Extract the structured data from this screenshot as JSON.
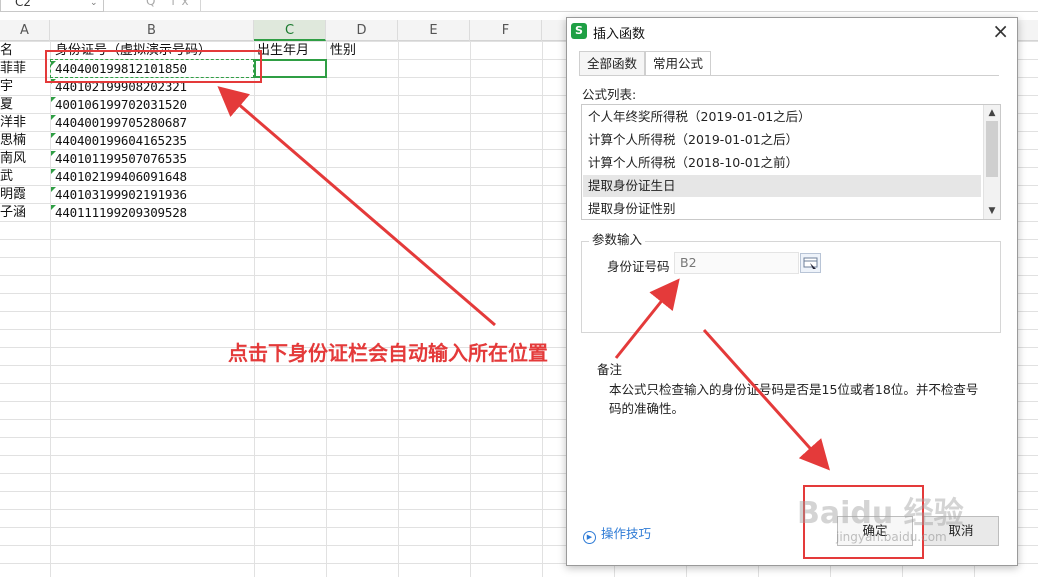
{
  "formula_bar": {
    "name_box": "C2",
    "fx_icons": "Q fx"
  },
  "columns": [
    {
      "label": "A",
      "active": false
    },
    {
      "label": "B",
      "active": false
    },
    {
      "label": "C",
      "active": true
    },
    {
      "label": "D",
      "active": false
    },
    {
      "label": "E",
      "active": false
    },
    {
      "label": "F",
      "active": false
    }
  ],
  "sheet": {
    "header": {
      "name": "名",
      "id": "身份证号（虚拟演示号码）",
      "birth": "出生年月",
      "gender": "性别"
    },
    "rows": [
      {
        "name": "菲菲",
        "id": "440400199812101850"
      },
      {
        "name": "宇",
        "id": "440102199908202321"
      },
      {
        "name": "夏",
        "id": "400106199702031520"
      },
      {
        "name": "洋非",
        "id": "440400199705280687"
      },
      {
        "name": "思楠",
        "id": "440400199604165235"
      },
      {
        "name": "南风",
        "id": "440101199507076535"
      },
      {
        "name": "武",
        "id": "440102199406091648"
      },
      {
        "name": "明霞",
        "id": "440103199902191936"
      },
      {
        "name": "子涵",
        "id": "440111199209309528"
      }
    ]
  },
  "dialog": {
    "title": "插入函数",
    "close": "×",
    "tabs": [
      {
        "label": "全部函数",
        "active": false
      },
      {
        "label": "常用公式",
        "active": true
      }
    ],
    "list_label": "公式列表:",
    "list_items": [
      {
        "label": "个人年终奖所得税（2019-01-01之后）",
        "selected": false
      },
      {
        "label": "计算个人所得税（2019-01-01之后）",
        "selected": false
      },
      {
        "label": "计算个人所得税（2018-10-01之前）",
        "selected": false
      },
      {
        "label": "提取身份证生日",
        "selected": true
      },
      {
        "label": "提取身份证性别",
        "selected": false
      }
    ],
    "param_title": "参数输入",
    "param_label": "身份证号码",
    "param_value": "B2",
    "note_title": "备注",
    "note_text": "本公式只检查输入的身份证号码是否是15位或者18位。并不检查号码的准确性。",
    "tips": "操作技巧",
    "ok": "确定",
    "cancel": "取消"
  },
  "annotation": "点击下身份证栏会自动输入所在位置",
  "watermark": {
    "main": "Baidu 经验",
    "sub": "jingyan.baidu.com"
  },
  "colors": {
    "accent": "#2f9e44",
    "annotation": "#e43a3a",
    "link": "#2e7bd6"
  }
}
